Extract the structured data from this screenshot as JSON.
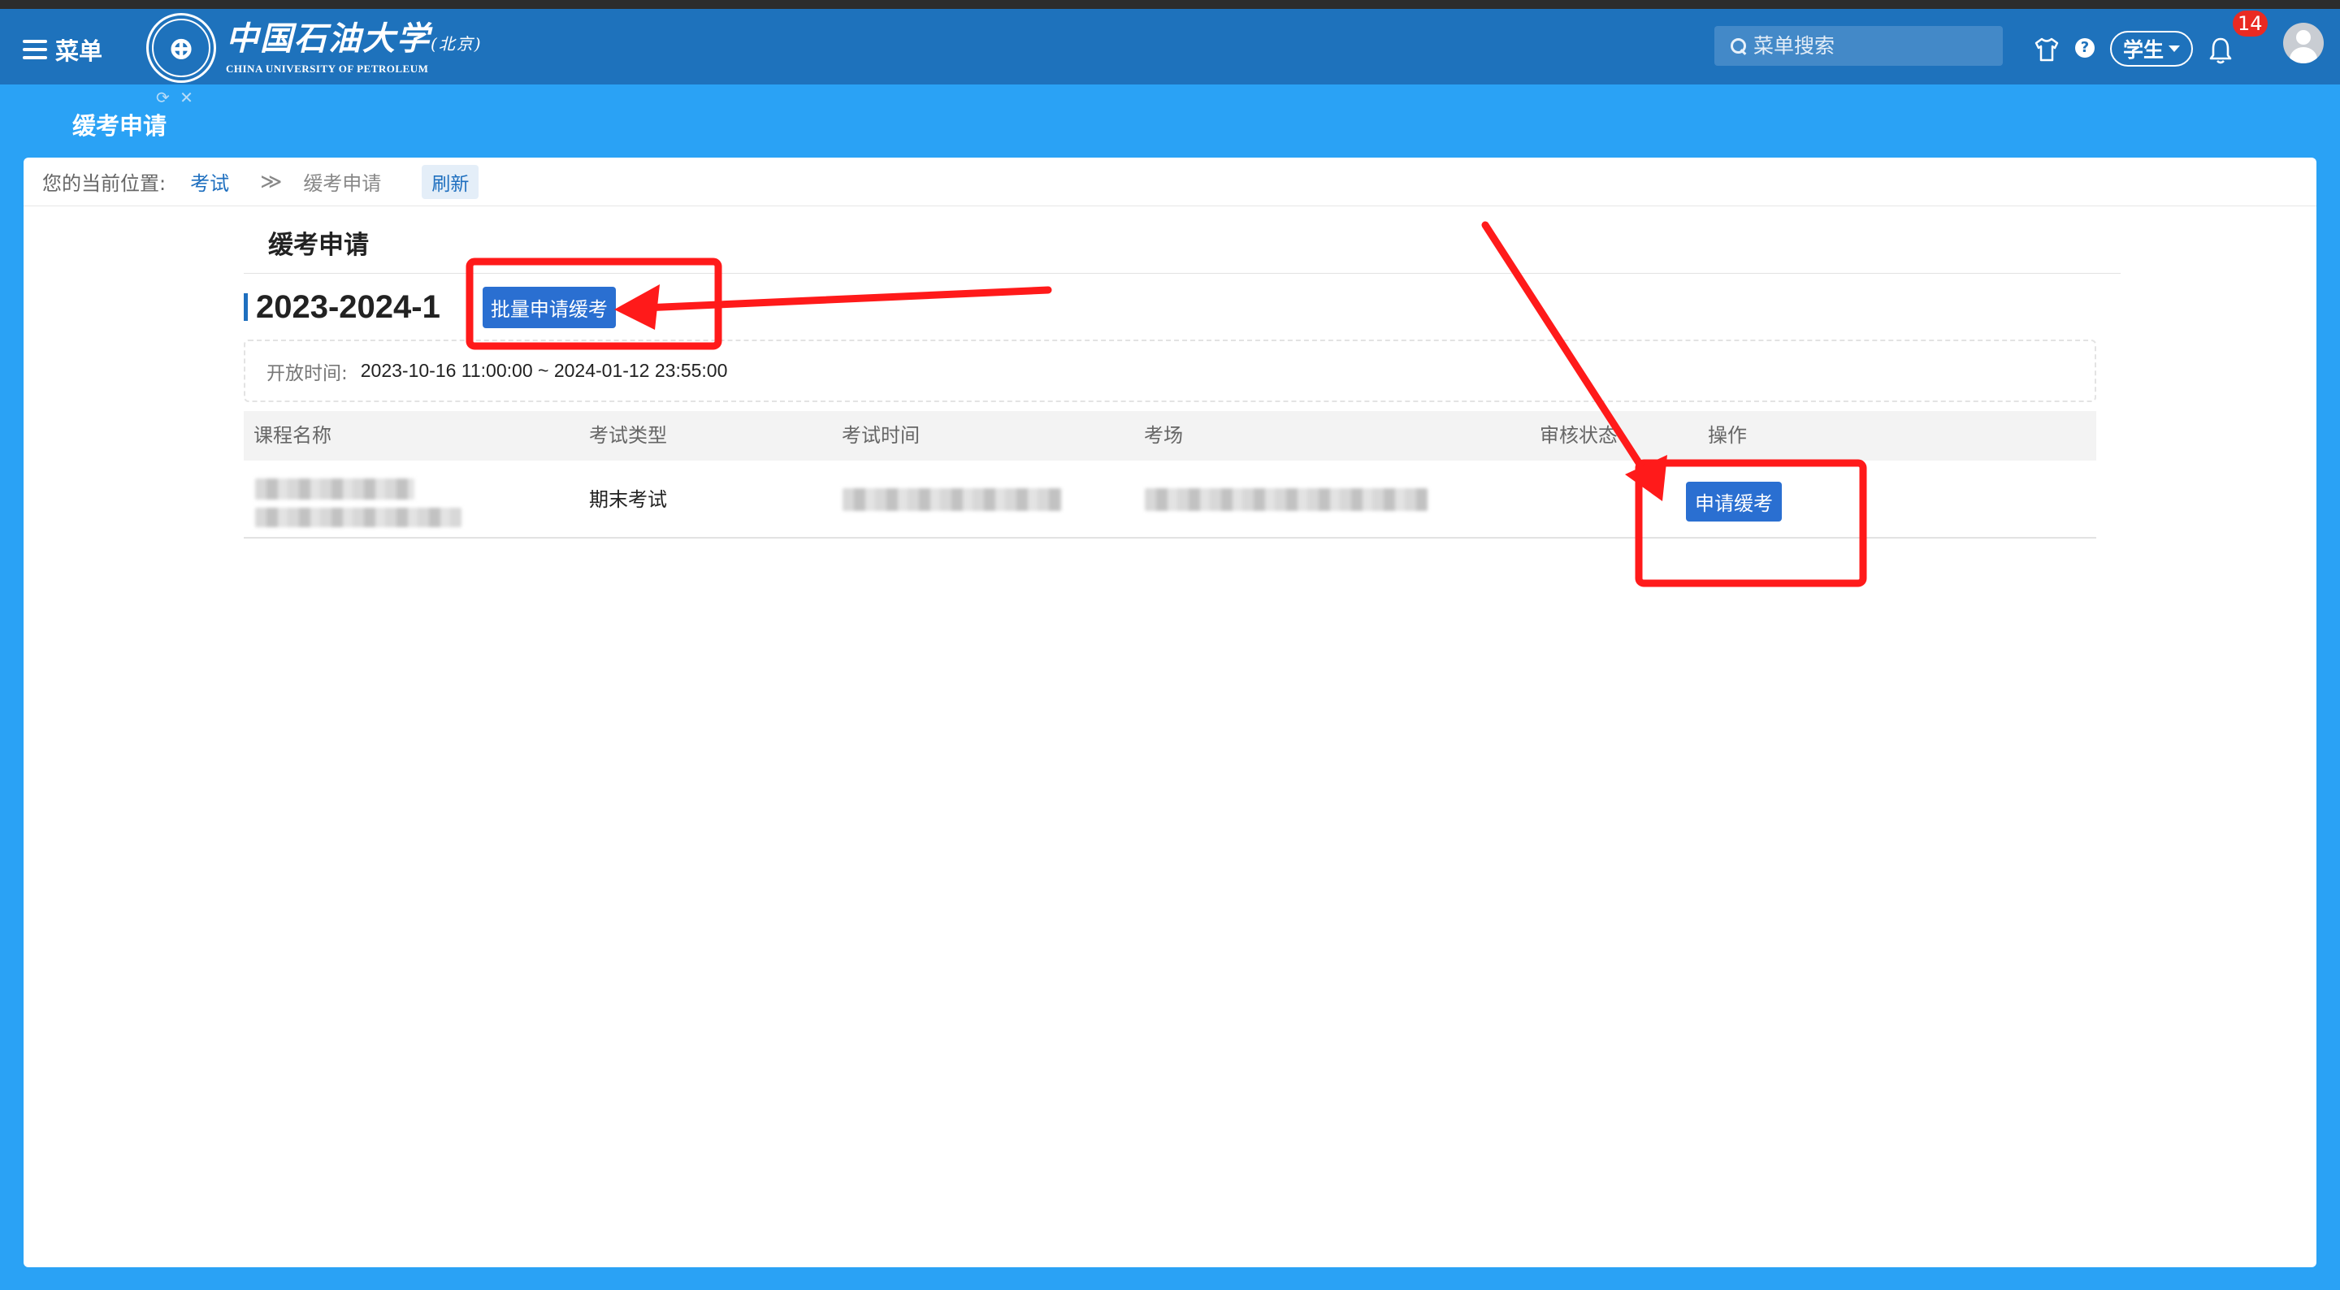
{
  "header": {
    "menu_label": "菜单",
    "logo_cn": "中国石油大学",
    "logo_cn_suffix": "(北京)",
    "logo_en": "CHINA UNIVERSITY OF PETROLEUM",
    "search_placeholder": "菜单搜索",
    "role": "学生",
    "notification_count": "14"
  },
  "tab": {
    "title": "缓考申请",
    "tools": [
      "⟳",
      "✕"
    ]
  },
  "breadcrumb": {
    "prefix": "您的当前位置:",
    "parent": "考试",
    "separator": "≫",
    "current": "缓考申请",
    "refresh_label": "刷新"
  },
  "page": {
    "title": "缓考申请",
    "term": "2023-2024-1",
    "batch_button": "批量申请缓考",
    "open_time_label": "开放时间:",
    "open_time_value": "2023-10-16 11:00:00 ~ 2024-01-12 23:55:00"
  },
  "table": {
    "columns": [
      "课程名称",
      "考试类型",
      "考试时间",
      "考场",
      "审核状态",
      "操作"
    ],
    "rows": [
      {
        "exam_type": "期末考试",
        "action": "申请缓考"
      }
    ]
  },
  "colors": {
    "header": "#1e72bc",
    "page_bg": "#2aa2f5",
    "primary_button": "#2a6fd1",
    "annotation": "#ff1a1a",
    "badge": "#ea2a22"
  }
}
